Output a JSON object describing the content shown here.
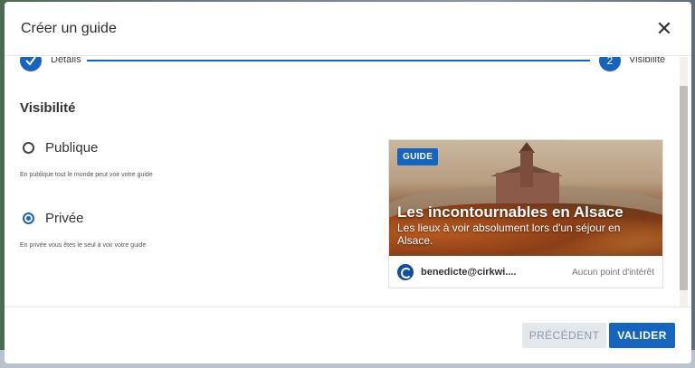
{
  "modal": {
    "title": "Créer un guide"
  },
  "stepper": {
    "steps": [
      {
        "label": "Détails",
        "number": "✓",
        "state": "done"
      },
      {
        "label": "Visibilité",
        "number": "2",
        "state": "current"
      }
    ]
  },
  "visibility": {
    "title": "Visibilité",
    "options": [
      {
        "label": "Publique",
        "help": "En publique tout le monde peut voir votre guide",
        "checked": false
      },
      {
        "label": "Privée",
        "help": "En privée vous êtes le seul à voir votre guide",
        "checked": true
      }
    ]
  },
  "preview": {
    "badge": "GUIDE",
    "title": "Les incontournables en Alsace",
    "subtitle": "Les lieux à voir absolument lors d'un séjour en Alsace.",
    "author": "benedicte@cirkwi....",
    "poi": "Aucun point d'intérêt"
  },
  "footer": {
    "prev_label": "PRÉCÉDENT",
    "valid_label": "VALIDER"
  },
  "colors": {
    "accent": "#1565c0"
  }
}
